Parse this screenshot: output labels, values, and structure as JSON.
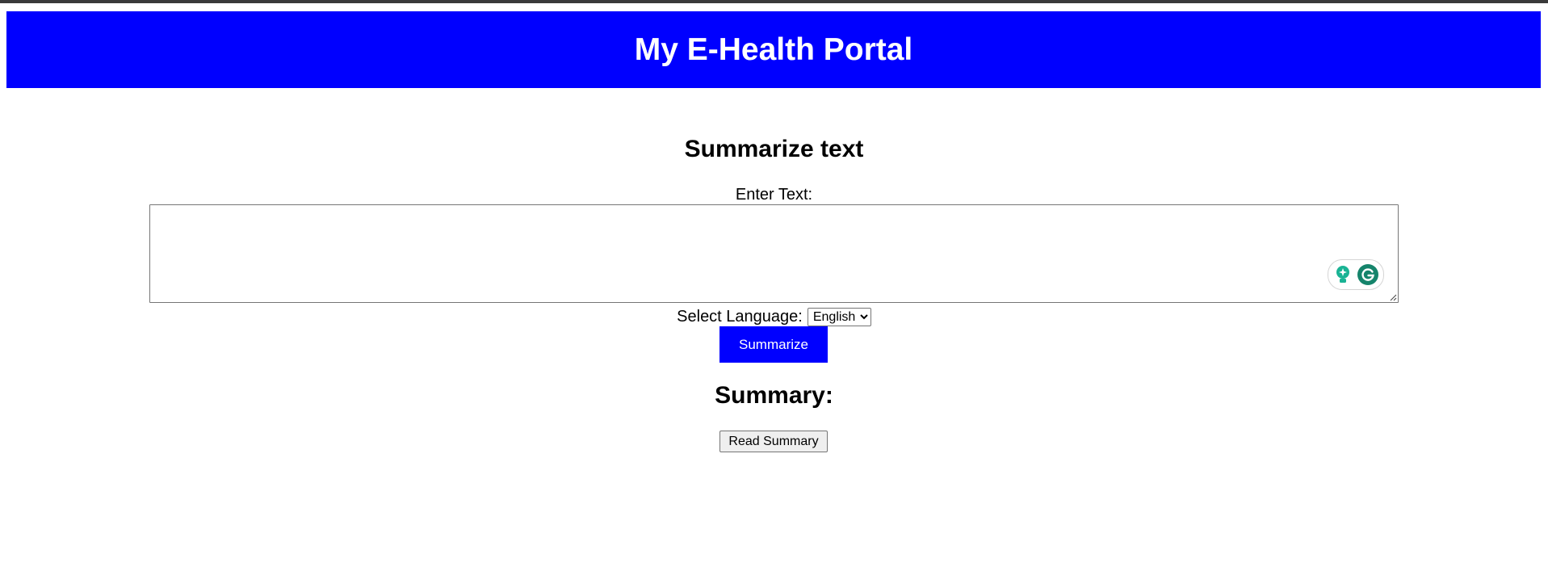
{
  "header": {
    "title": "My E-Health Portal",
    "bg_color": "#0000ff",
    "text_color": "#ffffff"
  },
  "summarizer": {
    "title": "Summarize text",
    "input_label": "Enter Text:",
    "input_value": "",
    "language_label": "Select Language:",
    "language_selected": "English",
    "language_options": [
      "English"
    ],
    "summarize_button_label": "Summarize",
    "summarize_button_color": "#0000ff"
  },
  "summary": {
    "heading": "Summary:",
    "read_button_label": "Read Summary"
  },
  "grammarly_widget": {
    "icons": [
      "lightbulb-icon",
      "grammarly-g-icon"
    ],
    "accent_color": "#15846b"
  }
}
